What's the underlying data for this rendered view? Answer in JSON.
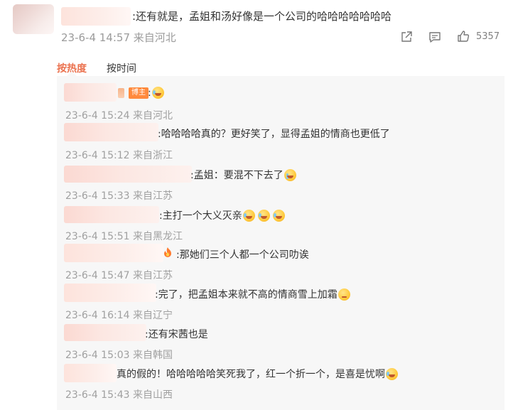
{
  "post": {
    "text": ":还有就是，孟姐和汤好像是一个公司的哈哈哈哈哈哈哈",
    "time_place": "23-6-4 14:57 来自河北",
    "like_count": "5357",
    "icons": [
      "share-icon",
      "comment-icon",
      "like-icon"
    ]
  },
  "sort_tabs": {
    "hot": "按热度",
    "time": "按时间"
  },
  "replies": [
    {
      "text": ":",
      "badge": "博主",
      "emoji": [
        "laugh-cry-emoji"
      ],
      "meta": "23-6-4 15:24 来自河北"
    },
    {
      "text": ":哈哈哈哈真的？更好笑了，显得孟姐的情商也更低了",
      "emoji": [],
      "meta": "23-6-4 15:12 来自浙江"
    },
    {
      "text": ":孟姐：要混不下去了",
      "emoji": [
        "crying-emoji"
      ],
      "meta": "23-6-4 15:33 来自江苏"
    },
    {
      "text": ":主打一个大义灭亲",
      "emoji": [
        "laugh-cry-emoji",
        "laugh-cry-emoji",
        "laugh-cry-emoji"
      ],
      "meta": "23-6-4 15:51 来自黑龙江"
    },
    {
      "text": ":那她们三个人都一个公司叻诶",
      "emoji": [],
      "meta": "23-6-4 15:47 来自江苏"
    },
    {
      "text": ":完了，把孟姐本来就不高的情商雪上加霜",
      "emoji": [
        "worried-emoji"
      ],
      "meta": "23-6-4 16:14 来自辽宁"
    },
    {
      "text": ":还有宋茜也是",
      "emoji": [],
      "meta": "23-6-4 15:03 来自韩国"
    },
    {
      "text": "真的假的！哈哈哈哈哈笑死我了，红一个折一个，是喜是忧啊",
      "emoji": [
        "laugh-cry-emoji"
      ],
      "meta": "23-6-4 15:43 来自山西"
    }
  ]
}
